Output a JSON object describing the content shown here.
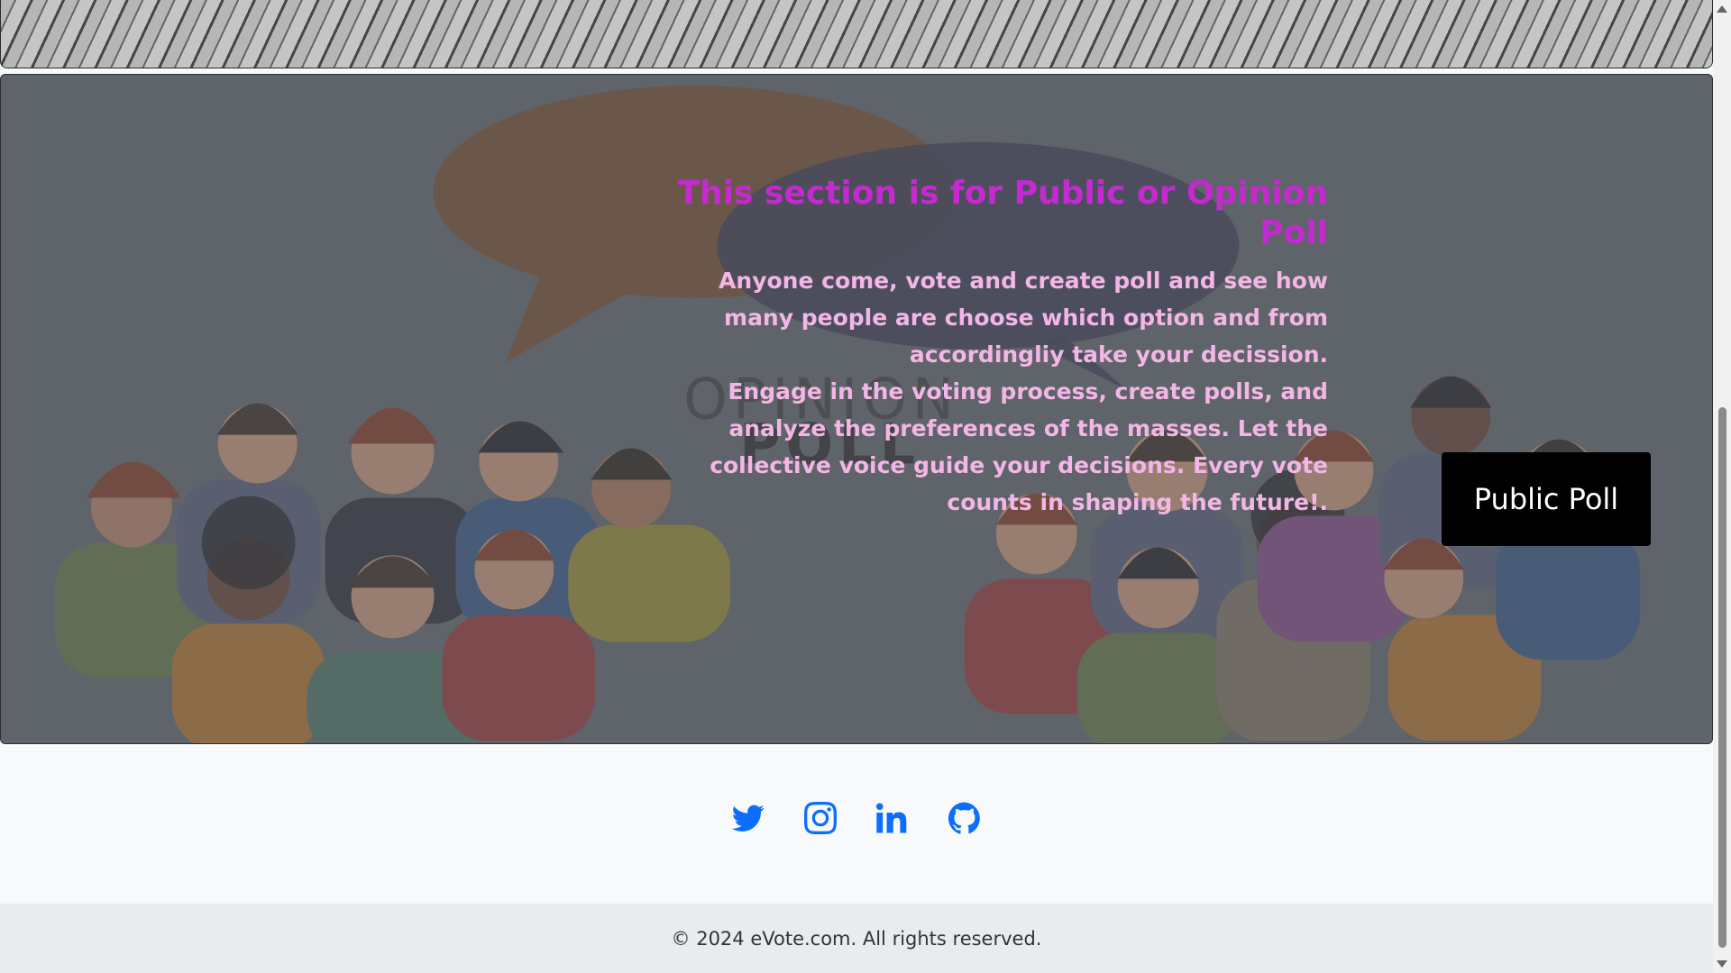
{
  "poll_section": {
    "title": "This section is for Public or Opinion Poll",
    "paragraph": "Anyone come, vote and create poll and see how many people are choose which option and from accordingliy take your decission.",
    "paragraph2": "Engage in the voting process, create polls, and analyze the preferences of the masses. Let the collective voice guide your decisions. Every vote counts in shaping the future!.",
    "button_label": "Public Poll",
    "illustration_text": [
      "OPINION",
      "POLL"
    ],
    "colors": {
      "title": "#c42ad0",
      "text": "#f3b6e6",
      "button_bg": "#000000"
    }
  },
  "social": {
    "icons": [
      "twitter-icon",
      "instagram-icon",
      "linkedin-icon",
      "github-icon"
    ],
    "color": "#0d6efd"
  },
  "footer": {
    "text": "© 2024 eVote.com. All rights reserved."
  }
}
